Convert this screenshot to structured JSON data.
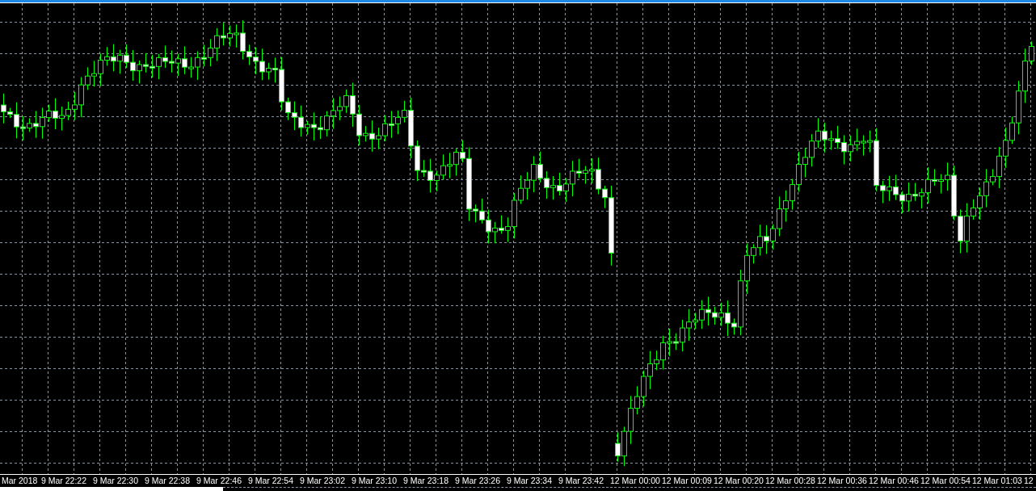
{
  "chart": {
    "time_axis_labels": [
      "Mar 2018",
      "9 Mar 22:22",
      "9 Mar 22:30",
      "9 Mar 22:38",
      "9 Mar 22:46",
      "9 Mar 22:54",
      "9 Mar 23:02",
      "9 Mar 23:10",
      "9 Mar 23:18",
      "9 Mar 23:26",
      "9 Mar 23:34",
      "9 Mar 23:42",
      "12 Mar 00:00",
      "12 Mar 00:09",
      "12 Mar 00:20",
      "12 Mar 00:28",
      "12 Mar 00:36",
      "12 Mar 00:46",
      "12 Mar 00:54",
      "12 Mar 01:03",
      "12"
    ]
  }
}
